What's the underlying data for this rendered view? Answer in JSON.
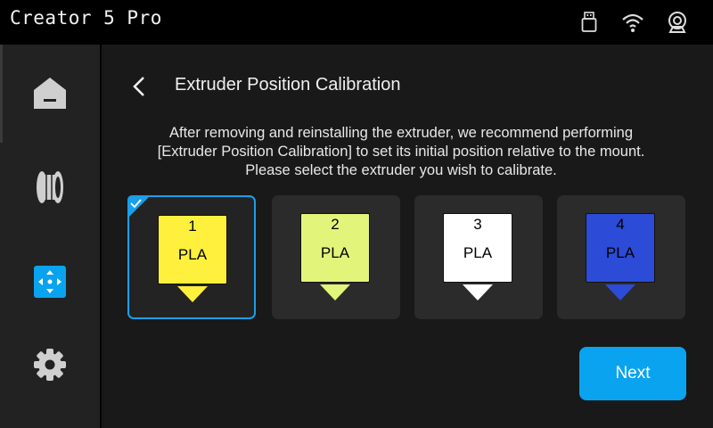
{
  "app": {
    "title": "Creator 5 Pro"
  },
  "status_icons": [
    "usb-drive-icon",
    "wifi-icon",
    "camera-icon"
  ],
  "sidebar": {
    "items": [
      {
        "name": "home",
        "icon": "home-icon",
        "active": false
      },
      {
        "name": "filament",
        "icon": "filament-spool-icon",
        "active": false
      },
      {
        "name": "move",
        "icon": "move-arrows-icon",
        "active": true
      },
      {
        "name": "settings",
        "icon": "gear-icon",
        "active": false
      }
    ]
  },
  "page": {
    "title": "Extruder Position Calibration",
    "description": [
      "After removing and reinstalling the extruder, we recommend performing",
      "[Extruder Position Calibration] to set its initial position relative to the mount.",
      "Please select the extruder you wish to calibrate."
    ]
  },
  "extruders": [
    {
      "number": "1",
      "material": "PLA",
      "color": "#fef03c",
      "selected": true
    },
    {
      "number": "2",
      "material": "PLA",
      "color": "#e2f57a",
      "selected": false
    },
    {
      "number": "3",
      "material": "PLA",
      "color": "#ffffff",
      "selected": false
    },
    {
      "number": "4",
      "material": "PLA",
      "color": "#2c4bd6",
      "selected": false
    }
  ],
  "actions": {
    "next_label": "Next"
  },
  "colors": {
    "accent": "#0aa3f0",
    "selected_border": "#1a9fe8"
  }
}
